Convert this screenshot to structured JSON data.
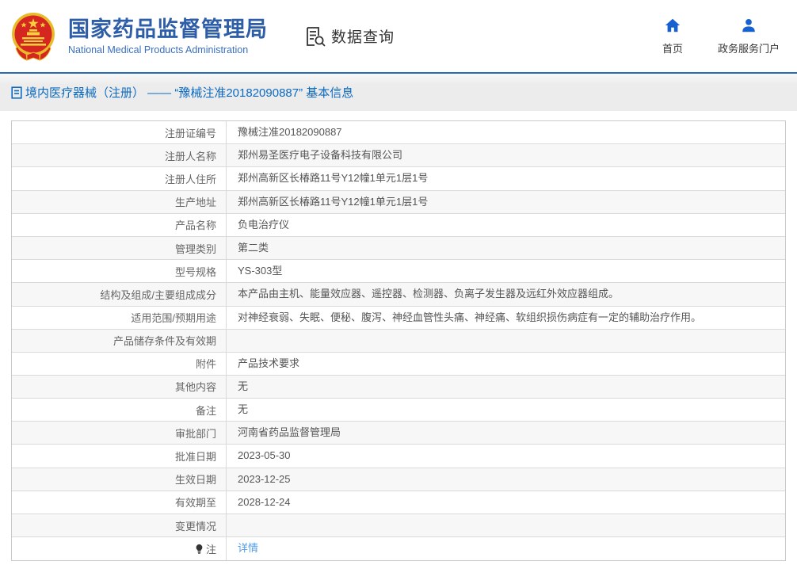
{
  "header": {
    "site_title_zh": "国家药品监督管理局",
    "site_title_en": "National Medical Products Administration",
    "data_query_label": "数据查询",
    "nav": [
      {
        "label": "首页",
        "icon": "home-icon"
      },
      {
        "label": "政务服务门户",
        "icon": "user-icon"
      }
    ]
  },
  "breadcrumb": {
    "text": "境内医疗器械（注册） —— “豫械注准20182090887” 基本信息"
  },
  "table": {
    "rows": [
      {
        "label": "注册证编号",
        "value": "豫械注准20182090887"
      },
      {
        "label": "注册人名称",
        "value": "郑州易圣医疗电子设备科技有限公司"
      },
      {
        "label": "注册人住所",
        "value": "郑州高新区长椿路11号Y12幢1单元1层1号"
      },
      {
        "label": "生产地址",
        "value": "郑州高新区长椿路11号Y12幢1单元1层1号"
      },
      {
        "label": "产品名称",
        "value": "负电治疗仪"
      },
      {
        "label": "管理类别",
        "value": "第二类"
      },
      {
        "label": "型号规格",
        "value": "YS-303型"
      },
      {
        "label": "结构及组成/主要组成成分",
        "value": "本产品由主机、能量效应器、遥控器、检测器、负离子发生器及远红外效应器组成。"
      },
      {
        "label": "适用范围/预期用途",
        "value": "对神经衰弱、失眠、便秘、腹泻、神经血管性头痛、神经痛、软组织损伤病症有一定的辅助治疗作用。"
      },
      {
        "label": "产品储存条件及有效期",
        "value": ""
      },
      {
        "label": "附件",
        "value": "产品技术要求"
      },
      {
        "label": "其他内容",
        "value": "无"
      },
      {
        "label": "备注",
        "value": "无"
      },
      {
        "label": "审批部门",
        "value": "河南省药品监督管理局"
      },
      {
        "label": "批准日期",
        "value": "2023-05-30"
      },
      {
        "label": "生效日期",
        "value": "2023-12-25"
      },
      {
        "label": "有效期至",
        "value": "2028-12-24"
      },
      {
        "label": "变更情况",
        "value": ""
      },
      {
        "label": "注",
        "value": "详情",
        "value_is_link": true,
        "label_icon": "lightbulb-icon"
      }
    ]
  },
  "colors": {
    "title_blue": "#2e5ea8",
    "subtitle_blue": "#3a6fc0",
    "accent_blue_line": "#2a6ab5",
    "breadcrumb_blue": "#0c6ac1",
    "nav_icon_blue": "#1660cf",
    "link_blue": "#4f9ce8",
    "row_alt_bg": "#f7f7f7",
    "border_gray": "#c9c9c9",
    "emblem_red": "#d5261f",
    "emblem_gold": "#e8bb2b"
  }
}
